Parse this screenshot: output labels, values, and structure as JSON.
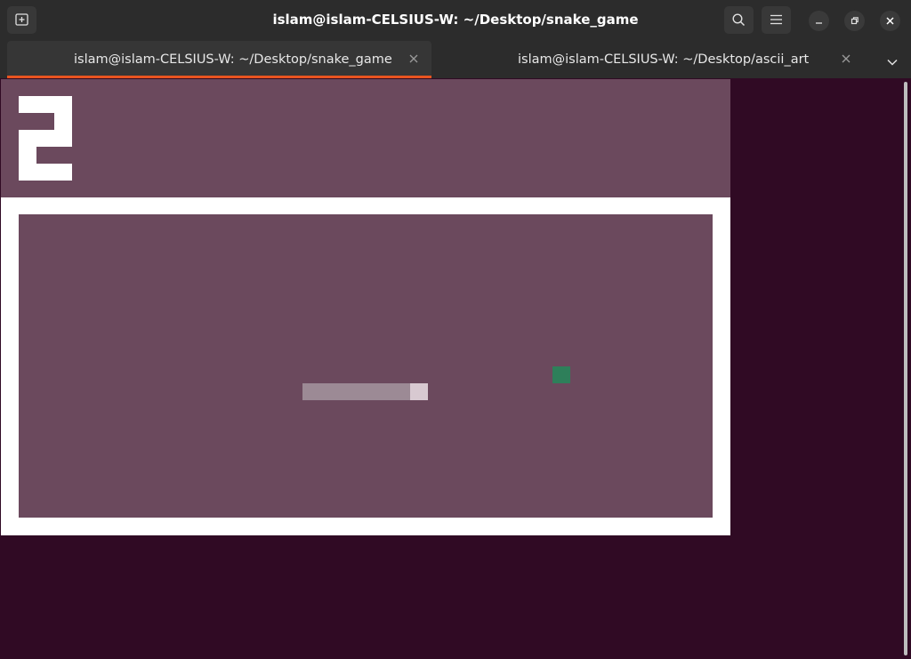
{
  "window": {
    "title": "islam@islam-CELSIUS-W: ~/Desktop/snake_game"
  },
  "tabs": [
    {
      "label": "islam@islam-CELSIUS-W: ~/Desktop/snake_game",
      "active": true
    },
    {
      "label": "islam@islam-CELSIUS-W: ~/Desktop/ascii_art",
      "active": false
    }
  ],
  "icons": {
    "new_tab": "new-tab-icon",
    "search": "search-icon",
    "menu": "hamburger-menu-icon",
    "minimize": "minimize-icon",
    "maximize": "maximize-icon",
    "close": "close-icon",
    "tab_close": "close-icon",
    "tab_dropdown": "chevron-down-icon"
  },
  "game": {
    "score": "2",
    "colors": {
      "background": "#6b495d",
      "border": "#ffffff",
      "snake_body": "#9c8a95",
      "snake_head": "#d8c9d1",
      "food": "#2e7f5a"
    }
  },
  "colors": {
    "terminal_bg": "#300a24",
    "headerbar": "#2c2c2c",
    "active_tab_accent": "#e95420"
  }
}
